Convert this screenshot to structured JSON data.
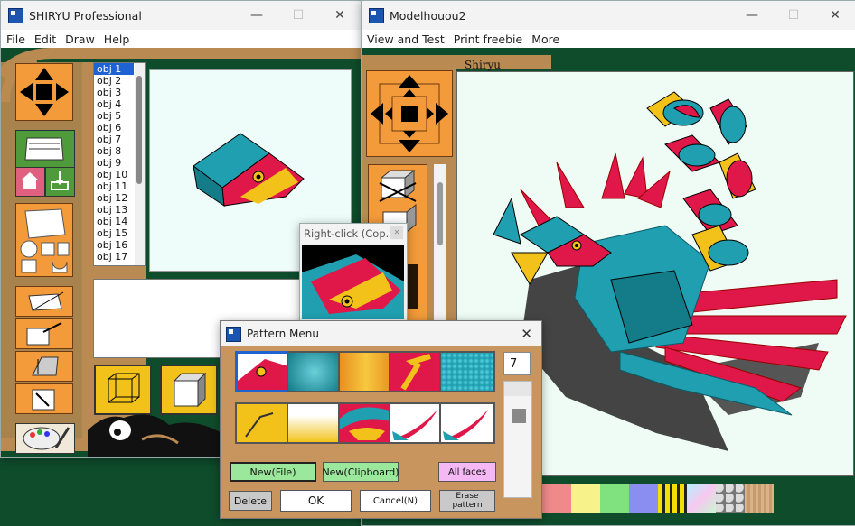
{
  "shiryu": {
    "title": "SHIRYU Professional",
    "menu": [
      "File",
      "Edit",
      "Draw",
      "Help"
    ],
    "objects": [
      "obj 1",
      "obj 2",
      "obj 3",
      "obj 4",
      "obj 5",
      "obj 6",
      "obj 7",
      "obj 8",
      "obj 9",
      "obj 10",
      "obj 11",
      "obj 12",
      "obj 13",
      "obj 14",
      "obj 15",
      "obj 16",
      "obj 17"
    ],
    "selected_object": "obj 1"
  },
  "model": {
    "title": "Modelhouou2",
    "menu": [
      "View and Test",
      "Print freebie",
      "More"
    ],
    "brand_label": "Shiryu"
  },
  "popup": {
    "title": "Right-click (Cop..."
  },
  "pattern_menu": {
    "title": "Pattern Menu",
    "count_value": "7",
    "buttons": {
      "new_file": "New(File)",
      "new_clipboard": "New(Clipboard)",
      "all_faces": "All faces",
      "delete": "Delete",
      "ok": "OK",
      "cancel": "Cancel(N)",
      "erase_line1": "Erase",
      "erase_line2": "pattern"
    }
  },
  "colors": {
    "desktop_green": "#0f4c2c",
    "wood": "#b98a52",
    "orange": "#f39b3a",
    "teal": "#1f9fb0",
    "crimson": "#e0184a",
    "yellow": "#f2c21b",
    "selection_blue": "#1f63d3"
  },
  "palette_swatches": [
    "#f08a8a",
    "#f7f28a",
    "#7fe27f",
    "#8a8ef0",
    "yellow-black-stripe",
    "iridescent",
    "stones",
    "wood-grain"
  ]
}
